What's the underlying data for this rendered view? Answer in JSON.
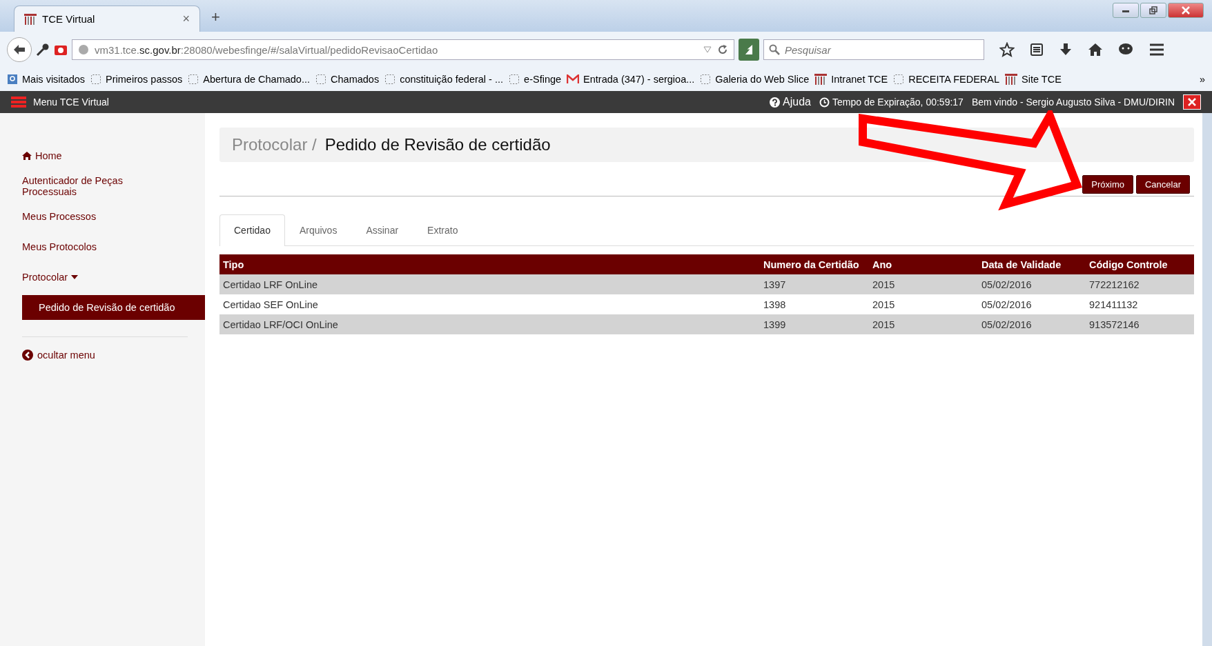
{
  "browser": {
    "tab_title": "TCE Virtual",
    "tab_close": "×",
    "new_tab": "+",
    "url": "vm31.tce.**sc.gov.br**:28080/webesfinge/#/salaVirtual/pedidoRevisaoCertidao",
    "search_placeholder": "Pesquisar",
    "bookmarks": [
      {
        "label": "Mais visitados",
        "kind": "search"
      },
      {
        "label": "Primeiros passos",
        "kind": "folder"
      },
      {
        "label": "Abertura de Chamado...",
        "kind": "folder"
      },
      {
        "label": "Chamados",
        "kind": "folder"
      },
      {
        "label": "constituição federal - ...",
        "kind": "folder"
      },
      {
        "label": "e-Sfinge",
        "kind": "folder"
      },
      {
        "label": "Entrada (347) - sergioa...",
        "kind": "mail"
      },
      {
        "label": "Galeria do Web Slice",
        "kind": "folder"
      },
      {
        "label": "Intranet TCE",
        "kind": "logo"
      },
      {
        "label": "RECEITA FEDERAL",
        "kind": "folder"
      },
      {
        "label": "Site TCE",
        "kind": "logo"
      }
    ],
    "overflow": "»"
  },
  "app_bar": {
    "menu_label": "Menu TCE Virtual",
    "help": "Ajuda",
    "expiration": "Tempo de Expiração, 00:59:17",
    "welcome": "Bem vindo - Sergio Augusto Silva - DMU/DIRIN"
  },
  "sidebar": {
    "items": [
      {
        "label": "Home",
        "kind": "home",
        "selected": false
      },
      {
        "label": "Autenticador de Peças Processuais",
        "kind": "link",
        "selected": false
      },
      {
        "label": "Meus Processos",
        "kind": "link",
        "selected": false
      },
      {
        "label": "Meus Protocolos",
        "kind": "link",
        "selected": false
      },
      {
        "label": "Protocolar",
        "kind": "group",
        "selected": false,
        "expanded": true,
        "children": [
          {
            "label": "Pedido de Revisão de certidão",
            "selected": true
          }
        ]
      }
    ],
    "hide_menu": "ocultar menu"
  },
  "page": {
    "breadcrumb": "Protocolar /",
    "title": "Pedido de Revisão de certidão",
    "buttons": [
      "Próximo",
      "Cancelar"
    ],
    "tabs": [
      {
        "label": "Certidao",
        "selected": true
      },
      {
        "label": "Arquivos",
        "selected": false
      },
      {
        "label": "Assinar",
        "selected": false
      },
      {
        "label": "Extrato",
        "selected": false
      }
    ],
    "table": {
      "columns": [
        "Tipo",
        "Numero da Certidão",
        "Ano",
        "Data de Validade",
        "Código Controle"
      ],
      "rows": [
        [
          "Certidao LRF OnLine",
          "1397",
          "2015",
          "05/02/2016",
          "772212162"
        ],
        [
          "Certidao SEF OnLine",
          "1398",
          "2015",
          "05/02/2016",
          "921411132"
        ],
        [
          "Certidao LRF/OCI OnLine",
          "1399",
          "2015",
          "05/02/2016",
          "913572146"
        ]
      ]
    }
  }
}
